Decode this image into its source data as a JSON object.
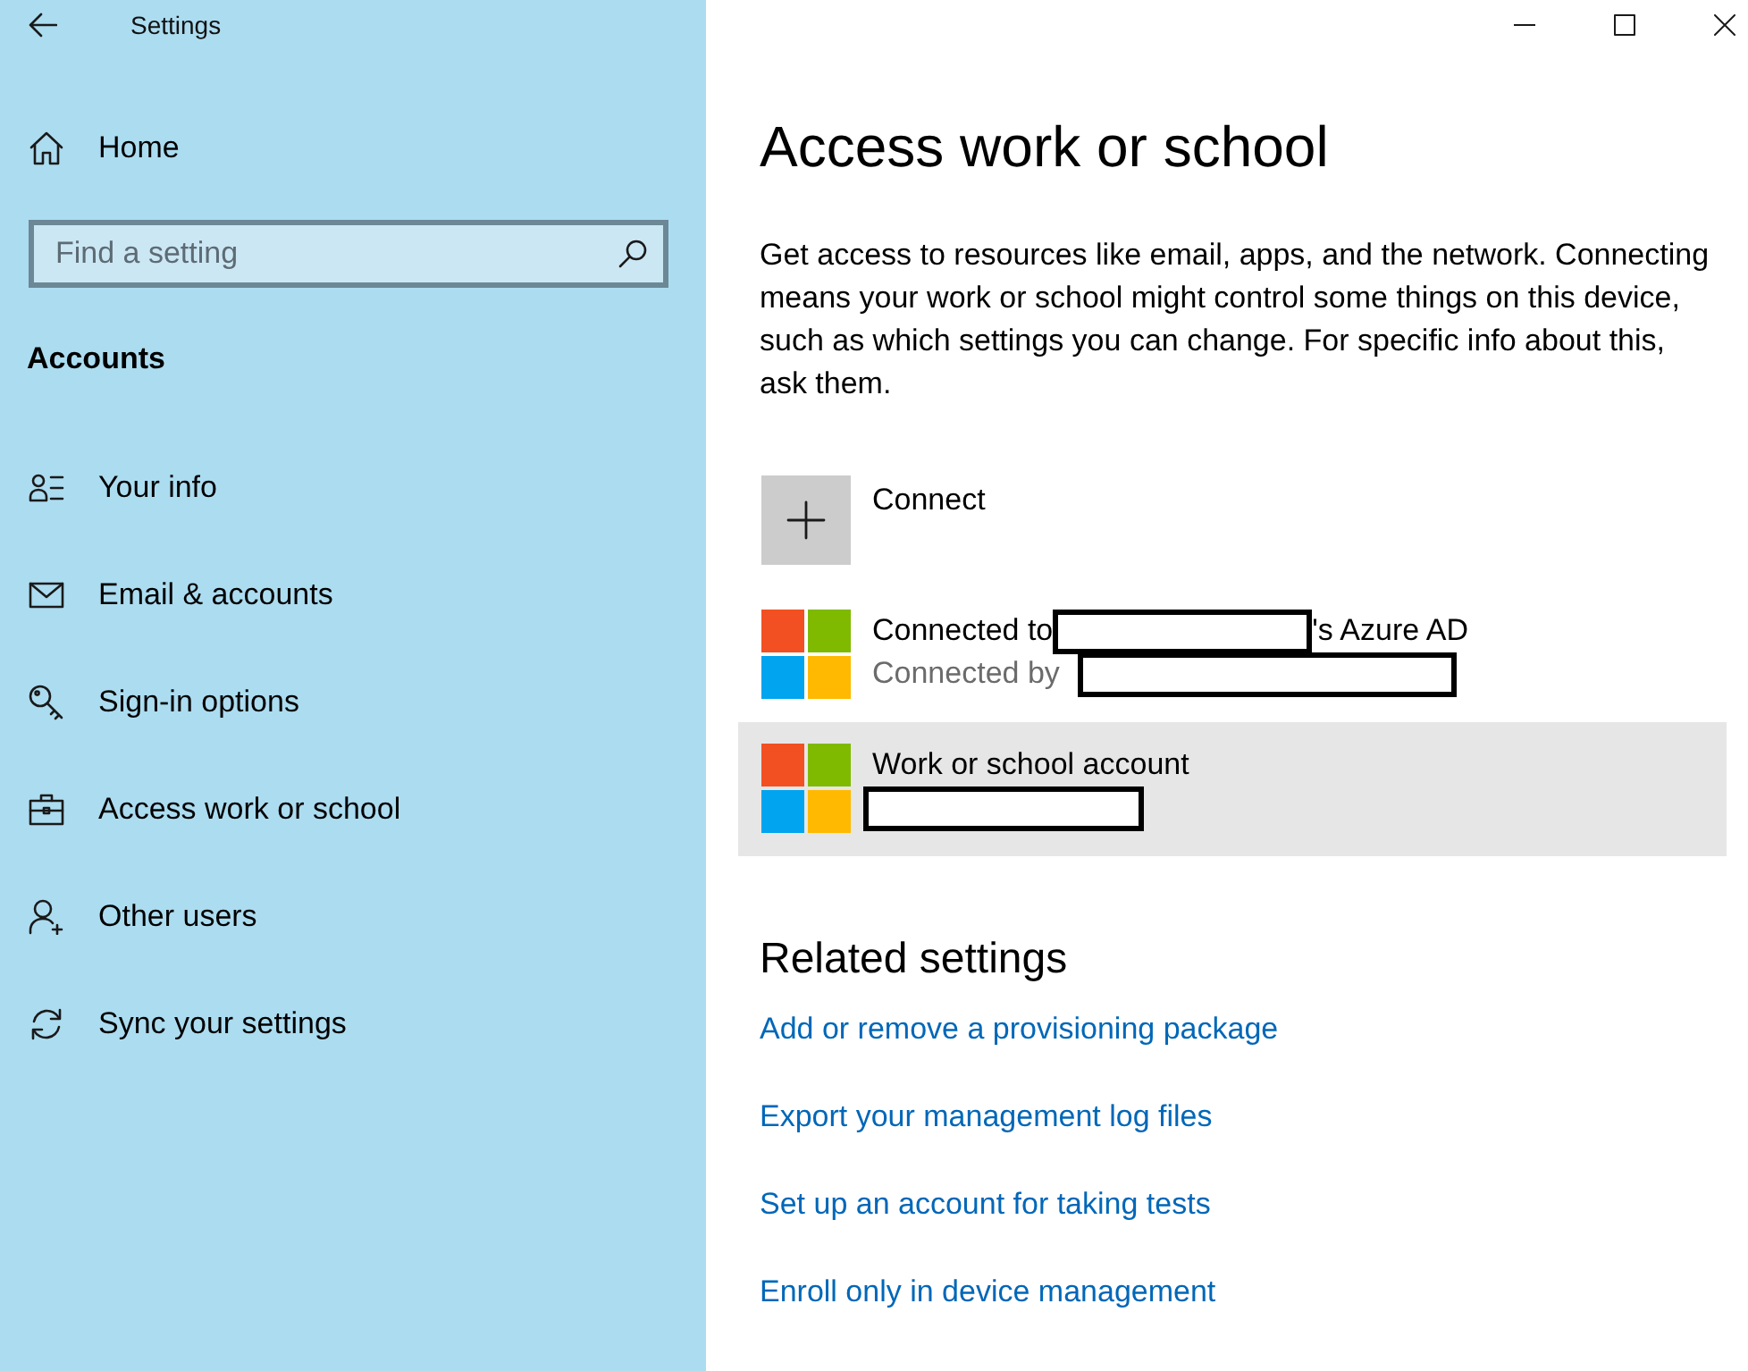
{
  "window": {
    "title": "Settings"
  },
  "sidebar": {
    "home": {
      "label": "Home"
    },
    "search": {
      "placeholder": "Find a setting"
    },
    "section": "Accounts",
    "items": [
      {
        "label": "Your info"
      },
      {
        "label": "Email & accounts"
      },
      {
        "label": "Sign-in options"
      },
      {
        "label": "Access work or school"
      },
      {
        "label": "Other users"
      },
      {
        "label": "Sync your settings"
      }
    ]
  },
  "page": {
    "title": "Access work or school",
    "description": "Get access to resources like email, apps, and the network. Connecting means your work or school might control some things on this device, such as which settings you can change. For specific info about this, ask them.",
    "items": [
      {
        "kind": "add",
        "selected": false,
        "label": "Connect"
      },
      {
        "kind": "account",
        "selected": false,
        "title_parts": [
          {
            "kind": "text",
            "text": "Connected to"
          },
          {
            "kind": "redaction"
          },
          {
            "kind": "text",
            "text": "'s Azure AD"
          }
        ],
        "subtitle_parts": [
          {
            "kind": "text",
            "text": "Connected by"
          },
          {
            "kind": "redaction"
          }
        ]
      },
      {
        "kind": "account",
        "selected": true,
        "title_parts": [
          {
            "kind": "text",
            "text": "Work or school account"
          }
        ],
        "subtitle_parts": [
          {
            "kind": "redaction"
          }
        ]
      }
    ]
  },
  "related": {
    "heading": "Related settings",
    "links": [
      "Add or remove a provisioning package",
      "Export your management log files",
      "Set up an account for taking tests",
      "Enroll only in device management"
    ]
  }
}
